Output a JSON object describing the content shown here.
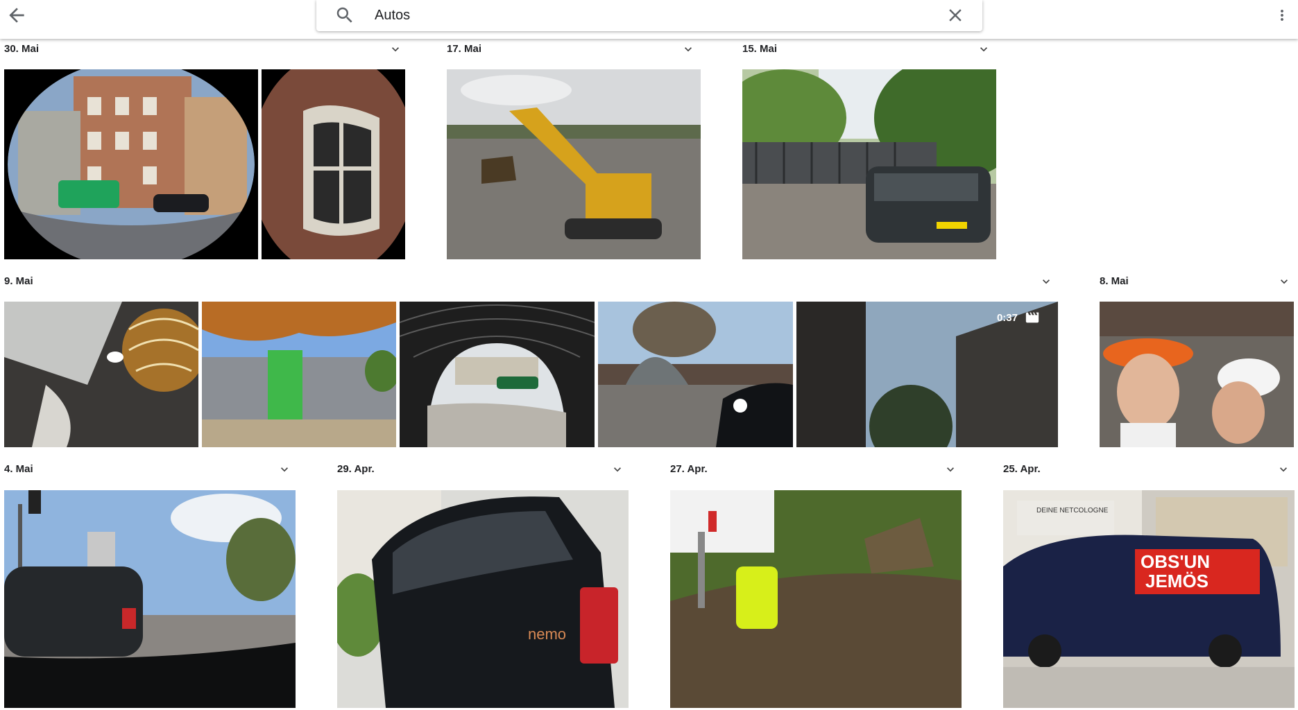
{
  "header": {
    "search_value": "Autos",
    "icons": {
      "back": "arrow-back-icon",
      "search": "search-icon",
      "clear": "close-icon",
      "more": "more-vert-icon"
    }
  },
  "groups": [
    {
      "date": "30. Mai"
    },
    {
      "date": "17. Mai"
    },
    {
      "date": "15. Mai"
    },
    {
      "date": "9. Mai"
    },
    {
      "date": "8. Mai"
    },
    {
      "date": "4. Mai"
    },
    {
      "date": "29. Apr."
    },
    {
      "date": "27. Apr."
    },
    {
      "date": "25. Apr."
    }
  ],
  "video": {
    "duration": "0:37",
    "icon": "movie-clapper-icon"
  },
  "photo_text": {
    "nemo_badge": "nemo",
    "van_sign_line1": "OBS'UN",
    "van_sign_line2": "JEMÖS",
    "shop_sign": "DEINE NETCOLOGNE"
  }
}
